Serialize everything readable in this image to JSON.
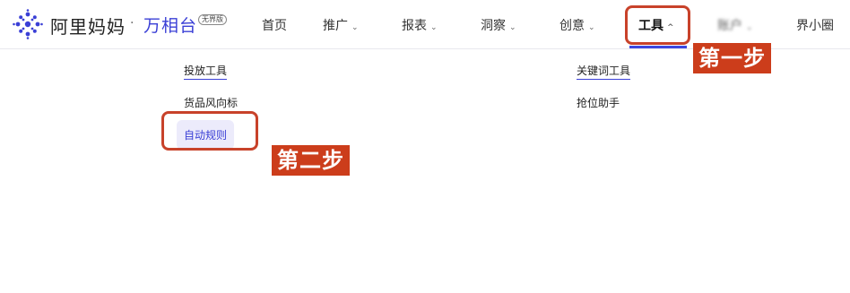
{
  "brand": {
    "name": "阿里妈妈",
    "separator": "·",
    "product": "万相台",
    "product_tag": "无界版",
    "accent_color": "#3a3fd6"
  },
  "nav": {
    "items": [
      {
        "label": "首页",
        "has_chevron": false
      },
      {
        "label": "推广",
        "has_chevron": true,
        "chevron": "⌄"
      },
      {
        "label": "报表",
        "has_chevron": true,
        "chevron": "⌄"
      },
      {
        "label": "洞察",
        "has_chevron": true,
        "chevron": "⌄"
      },
      {
        "label": "创意",
        "has_chevron": true,
        "chevron": "⌄"
      },
      {
        "label": "工具",
        "has_chevron": true,
        "chevron": "^",
        "active": true
      },
      {
        "label": "账户",
        "has_chevron": true,
        "chevron": "⌄",
        "obscured": true
      },
      {
        "label": "界小圈",
        "has_chevron": false
      }
    ]
  },
  "tools_menu": {
    "left_column": [
      {
        "label": "投放工具",
        "style": "section-header"
      },
      {
        "label": "货品风向标"
      },
      {
        "label": "自动规则",
        "selected": true
      }
    ],
    "right_column": [
      {
        "label": "关键词工具",
        "style": "section-header"
      },
      {
        "label": "抢位助手"
      }
    ]
  },
  "annotations": {
    "step1": "第一步",
    "step2": "第二步",
    "color": "#cc3d1b"
  }
}
